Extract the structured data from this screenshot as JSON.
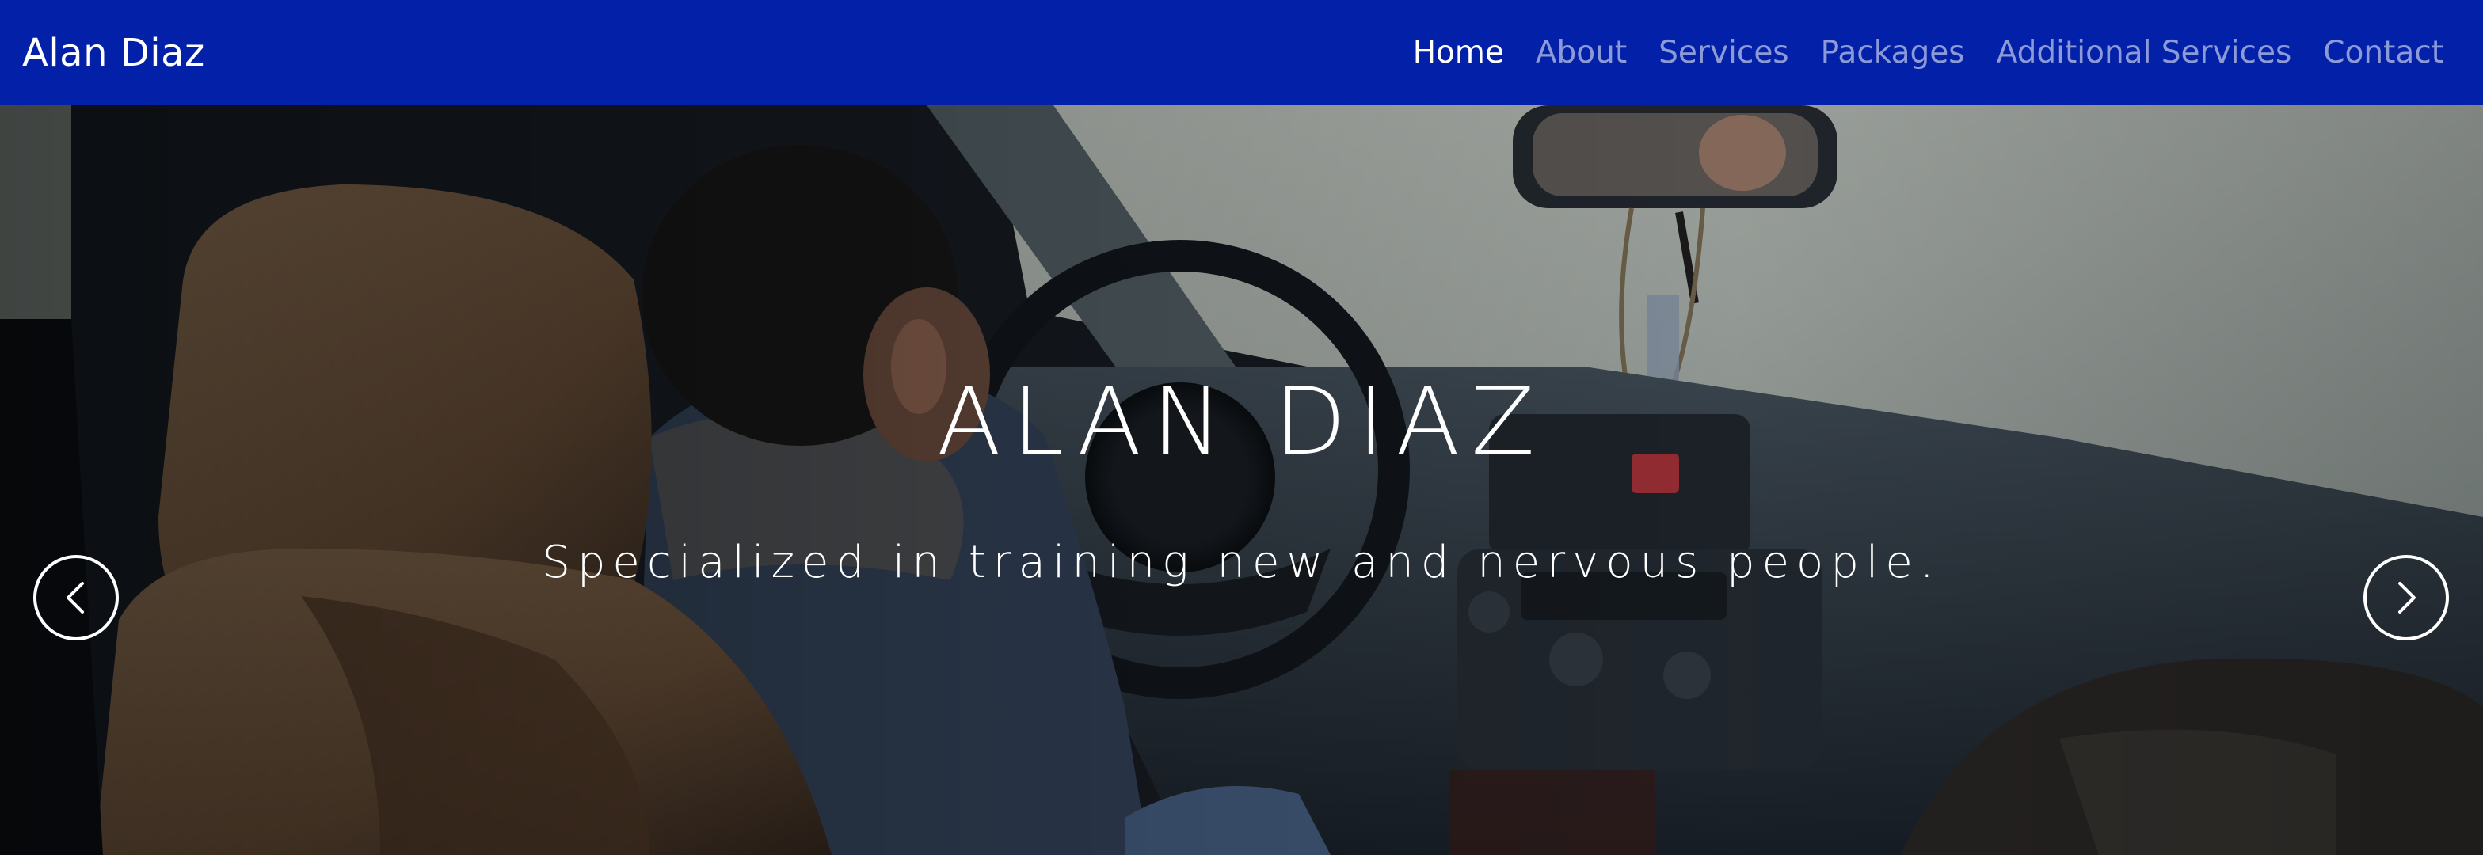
{
  "navbar": {
    "brand": "Alan Diaz",
    "background": "#0320a8",
    "links": [
      {
        "label": "Home",
        "active": true
      },
      {
        "label": "About",
        "active": false
      },
      {
        "label": "Services",
        "active": false
      },
      {
        "label": "Packages",
        "active": false
      },
      {
        "label": "Additional Services",
        "active": false
      },
      {
        "label": "Contact",
        "active": false
      }
    ]
  },
  "hero": {
    "title": "ALAN DIAZ",
    "subtitle": "Specialized in training new and nervous people.",
    "background_image": "photo-man-driving-car-interior",
    "controls": {
      "prev_icon": "chevron-left-icon",
      "next_icon": "chevron-right-icon"
    }
  }
}
